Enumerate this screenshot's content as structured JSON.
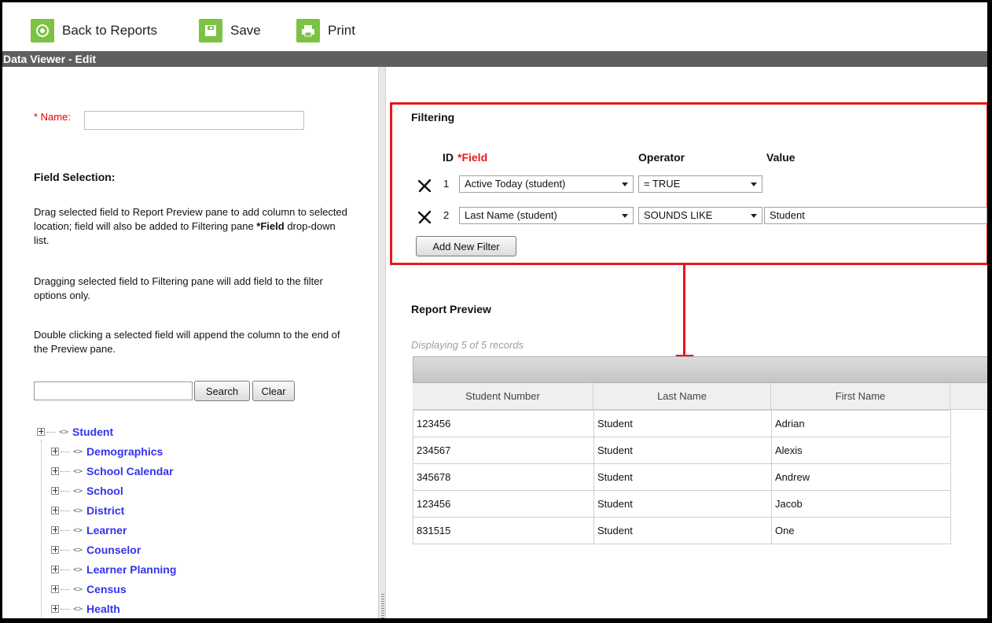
{
  "toolbar": {
    "back_label": "Back to Reports",
    "save_label": "Save",
    "print_label": "Print"
  },
  "title_bar": "Data Viewer - Edit",
  "left": {
    "name_required": "* Name:",
    "name_value": "",
    "field_selection_heading": "Field Selection:",
    "help1_a": "Drag selected field to Report Preview pane to add column to selected location; field will also be added to Filtering pane ",
    "help1_bold": "*Field",
    "help1_b": " drop-down list.",
    "help2": "Dragging selected field to Filtering pane will add field to the filter options only.",
    "help3": "Double clicking a selected field will append the column to the end of the Preview pane.",
    "search_value": "",
    "search_label": "Search",
    "clear_label": "Clear",
    "tree": {
      "root": "Student",
      "children": [
        "Demographics",
        "School Calendar",
        "School",
        "District",
        "Learner",
        "Counselor",
        "Learner Planning",
        "Census",
        "Health"
      ]
    }
  },
  "filtering": {
    "title": "Filtering",
    "col_id": "ID",
    "col_field": "*Field",
    "col_operator": "Operator",
    "col_value": "Value",
    "rows": [
      {
        "id": "1",
        "field": "Active Today (student)",
        "operator": "= TRUE",
        "value": null
      },
      {
        "id": "2",
        "field": "Last Name (student)",
        "operator": "SOUNDS LIKE",
        "value": "Student"
      }
    ],
    "add_label": "Add New Filter"
  },
  "preview": {
    "title": "Report Preview",
    "count": "Displaying 5 of 5 records",
    "columns": [
      "Student Number",
      "Last Name",
      "First Name"
    ],
    "rows": [
      [
        "123456",
        "Student",
        "Adrian"
      ],
      [
        "234567",
        "Student",
        "Alexis"
      ],
      [
        "345678",
        "Student",
        "Andrew"
      ],
      [
        "123456",
        "Student",
        "Jacob"
      ],
      [
        "831515",
        "Student",
        "One"
      ]
    ]
  },
  "colors": {
    "accent_green": "#7cc243",
    "highlight_red": "#e81818",
    "tree_link": "#3333ee",
    "title_bar": "#5f5f5f"
  }
}
